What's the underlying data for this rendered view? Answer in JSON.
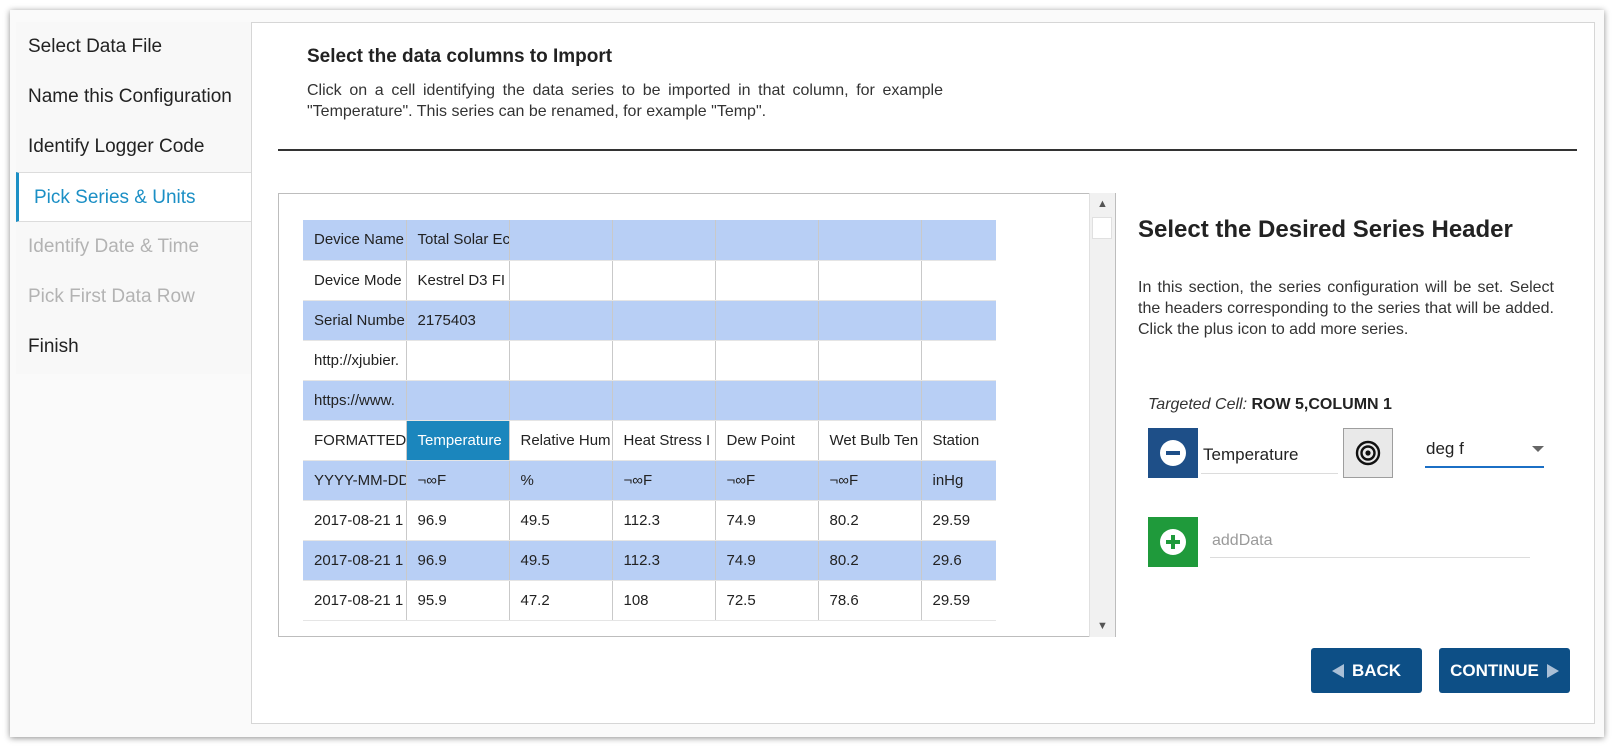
{
  "sidebar": {
    "steps": [
      {
        "label": "Select Data File"
      },
      {
        "label": "Name this Configuration"
      },
      {
        "label": "Identify Logger Code"
      },
      {
        "label": "Pick Series & Units"
      },
      {
        "label": "Identify Date & Time"
      },
      {
        "label": "Pick First Data Row"
      },
      {
        "label": "Finish"
      }
    ],
    "active_step": "Pick Series & Units"
  },
  "header": {
    "title": "Select the data columns to Import",
    "description": "Click on a cell identifying the data series to be imported in that column, for example \"Temperature\". This series can be renamed, for example \"Temp\"."
  },
  "grid": {
    "rows": [
      [
        "Device Name",
        "Total Solar Ec",
        "",
        "",
        "",
        ""
      ],
      [
        "Device Mode",
        "Kestrel D3 FI",
        "",
        "",
        "",
        ""
      ],
      [
        "Serial Numbe",
        "2175403",
        "",
        "",
        "",
        ""
      ],
      [
        "http://xjubier.",
        "",
        "",
        "",
        "",
        ""
      ],
      [
        "https://www.",
        "",
        "",
        "",
        "",
        ""
      ],
      [
        "FORMATTED",
        "Temperature",
        "Relative Hum",
        "Heat Stress I",
        "Dew Point",
        "Wet Bulb Ten",
        "Station"
      ],
      [
        "YYYY-MM-DD",
        "¬∞F",
        "%",
        "¬∞F",
        "¬∞F",
        "¬∞F",
        "inHg"
      ],
      [
        "2017-08-21 1",
        "96.9",
        "49.5",
        "112.3",
        "74.9",
        "80.2",
        "29.59"
      ],
      [
        "2017-08-21 1",
        "96.9",
        "49.5",
        "112.3",
        "74.9",
        "80.2",
        "29.6"
      ],
      [
        "2017-08-21 1",
        "95.9",
        "47.2",
        "108",
        "72.5",
        "78.6",
        "29.59"
      ]
    ],
    "selected_cell": {
      "row": 5,
      "col": 1
    }
  },
  "series_panel": {
    "title": "Select the Desired Series Header",
    "description": "In this section, the series configuration will be set. Select the headers corresponding to the series that will be added. Click the plus icon to add more series.",
    "targeted_label": "Targeted Cell:",
    "targeted_value": "ROW 5,COLUMN 1",
    "series_name": "Temperature",
    "unit_value": "deg f",
    "add_placeholder": "addData"
  },
  "buttons": {
    "back": "BACK",
    "continue": "CONTINUE"
  },
  "colors": {
    "accent": "#1b8fc5",
    "nav_button": "#0d4f86",
    "remove_button": "#1e4f88",
    "add_button": "#1f9a3b",
    "grid_alt_row": "#b8cff5",
    "grid_selected": "#1b86bd"
  },
  "icons": {
    "remove": "minus-circle-icon",
    "add": "plus-circle-icon",
    "target": "target-icon",
    "dropdown": "caret-down-icon"
  }
}
